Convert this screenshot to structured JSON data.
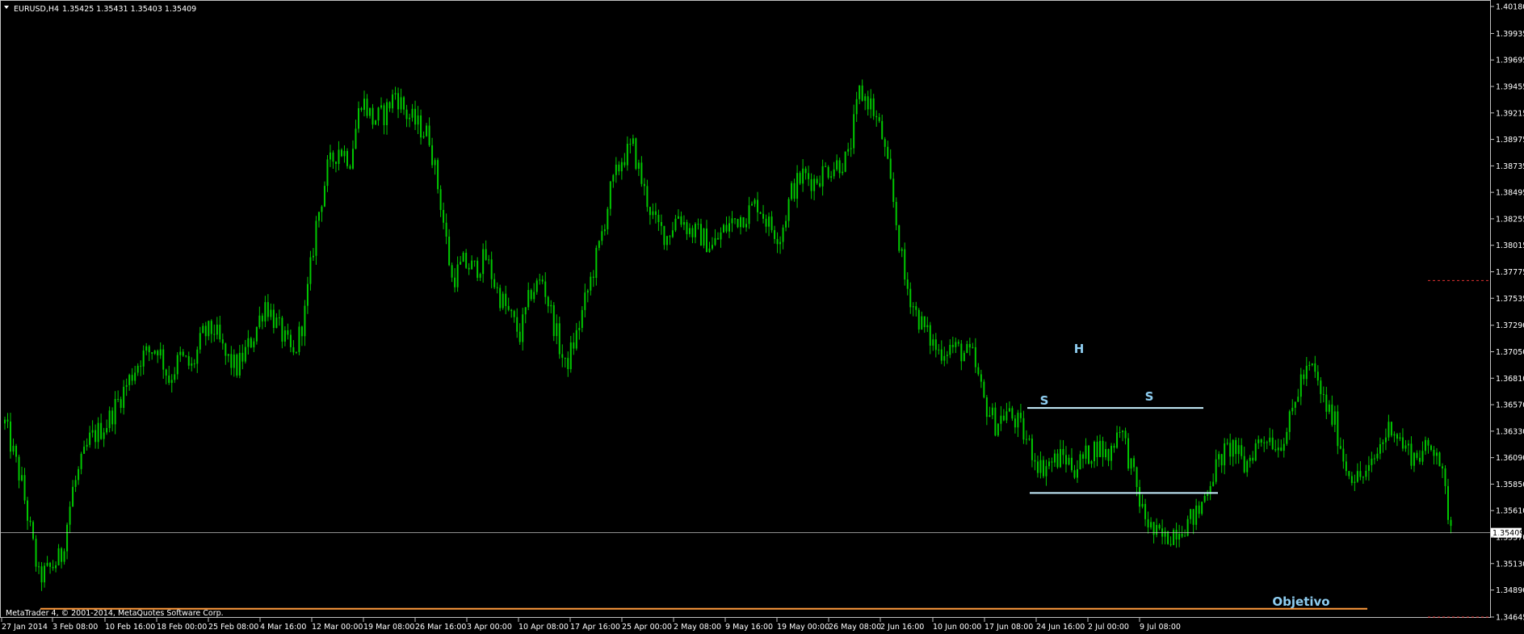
{
  "window": {
    "symbol_label": "EURUSD,H4",
    "ohlc_label": "1.35425 1.35431 1.35403 1.35409",
    "copyright": "MetaTrader 4, © 2001-2014, MetaQuotes Software Corp.",
    "dropdown_icon": "triangle-down-icon"
  },
  "colors": {
    "background": "#000000",
    "candles": "#00c800",
    "axis": "#c0c0c0",
    "pattern_lines": "#c8f0ff",
    "pattern_text": "#8ecdf0",
    "target_line": "#ff9a3c",
    "bid_line": "#c0c0c0",
    "alert_marker": "#e03030"
  },
  "chart_data": {
    "type": "bar",
    "symbol": "EURUSD",
    "timeframe": "H4",
    "current_price": "1.35409",
    "ylim": [
      1.34645,
      1.4018
    ],
    "y_ticks": [
      "1.40180",
      "1.39935",
      "1.39695",
      "1.39455",
      "1.39215",
      "1.38975",
      "1.38735",
      "1.38495",
      "1.38255",
      "1.38015",
      "1.37775",
      "1.37535",
      "1.37290",
      "1.37050",
      "1.36810",
      "1.36570",
      "1.36330",
      "1.36090",
      "1.35850",
      "1.35610",
      "1.35370",
      "1.35130",
      "1.34890",
      "1.34645"
    ],
    "x_ticks": [
      "27 Jan 2014",
      "3 Feb 08:00",
      "10 Feb 16:00",
      "18 Feb 00:00",
      "25 Feb 08:00",
      "4 Mar 16:00",
      "12 Mar 00:00",
      "19 Mar 08:00",
      "26 Mar 16:00",
      "3 Apr 00:00",
      "10 Apr 08:00",
      "17 Apr 16:00",
      "25 Apr 00:00",
      "2 May 08:00",
      "9 May 16:00",
      "19 May 00:00",
      "26 May 08:00",
      "2 Jun 16:00",
      "10 Jun 00:00",
      "17 Jun 08:00",
      "24 Jun 16:00",
      "2 Jul 00:00",
      "9 Jul 08:00"
    ],
    "price_path": [
      [
        0,
        1.364
      ],
      [
        6,
        1.3585
      ],
      [
        12,
        1.35
      ],
      [
        16,
        1.3508
      ],
      [
        20,
        1.352
      ],
      [
        24,
        1.358
      ],
      [
        30,
        1.3625
      ],
      [
        36,
        1.364
      ],
      [
        40,
        1.366
      ],
      [
        48,
        1.37
      ],
      [
        54,
        1.371
      ],
      [
        58,
        1.368
      ],
      [
        62,
        1.37
      ],
      [
        66,
        1.369
      ],
      [
        70,
        1.372
      ],
      [
        74,
        1.3725
      ],
      [
        78,
        1.37
      ],
      [
        82,
        1.369
      ],
      [
        88,
        1.372
      ],
      [
        92,
        1.375
      ],
      [
        98,
        1.372
      ],
      [
        102,
        1.37
      ],
      [
        106,
        1.374
      ],
      [
        110,
        1.382
      ],
      [
        114,
        1.387
      ],
      [
        118,
        1.389
      ],
      [
        122,
        1.388
      ],
      [
        126,
        1.3935
      ],
      [
        130,
        1.3915
      ],
      [
        134,
        1.392
      ],
      [
        138,
        1.394
      ],
      [
        142,
        1.392
      ],
      [
        146,
        1.391
      ],
      [
        150,
        1.39
      ],
      [
        154,
        1.384
      ],
      [
        158,
        1.377
      ],
      [
        162,
        1.3785
      ],
      [
        166,
        1.378
      ],
      [
        170,
        1.379
      ],
      [
        174,
        1.376
      ],
      [
        178,
        1.374
      ],
      [
        182,
        1.372
      ],
      [
        186,
        1.376
      ],
      [
        190,
        1.377
      ],
      [
        194,
        1.373
      ],
      [
        198,
        1.369
      ],
      [
        202,
        1.372
      ],
      [
        206,
        1.376
      ],
      [
        210,
        1.38
      ],
      [
        214,
        1.385
      ],
      [
        218,
        1.388
      ],
      [
        222,
        1.389
      ],
      [
        226,
        1.385
      ],
      [
        230,
        1.382
      ],
      [
        234,
        1.381
      ],
      [
        238,
        1.383
      ],
      [
        242,
        1.3815
      ],
      [
        246,
        1.381
      ],
      [
        250,
        1.38
      ],
      [
        254,
        1.3815
      ],
      [
        258,
        1.3825
      ],
      [
        262,
        1.383
      ],
      [
        266,
        1.384
      ],
      [
        270,
        1.382
      ],
      [
        274,
        1.381
      ],
      [
        278,
        1.385
      ],
      [
        282,
        1.3865
      ],
      [
        286,
        1.386
      ],
      [
        290,
        1.387
      ],
      [
        294,
        1.3875
      ],
      [
        298,
        1.388
      ],
      [
        302,
        1.394
      ],
      [
        306,
        1.393
      ],
      [
        310,
        1.39
      ],
      [
        314,
        1.384
      ],
      [
        318,
        1.377
      ],
      [
        322,
        1.374
      ],
      [
        326,
        1.372
      ],
      [
        330,
        1.3705
      ],
      [
        334,
        1.371
      ],
      [
        338,
        1.3705
      ],
      [
        342,
        1.37
      ],
      [
        346,
        1.366
      ],
      [
        350,
        1.364
      ],
      [
        354,
        1.365
      ],
      [
        358,
        1.364
      ],
      [
        362,
        1.362
      ],
      [
        366,
        1.36
      ],
      [
        370,
        1.3605
      ],
      [
        374,
        1.361
      ],
      [
        378,
        1.36
      ],
      [
        382,
        1.361
      ],
      [
        386,
        1.362
      ],
      [
        390,
        1.361
      ],
      [
        394,
        1.364
      ],
      [
        398,
        1.36
      ],
      [
        402,
        1.356
      ],
      [
        406,
        1.354
      ],
      [
        410,
        1.3535
      ],
      [
        414,
        1.3545
      ],
      [
        418,
        1.355
      ],
      [
        422,
        1.356
      ],
      [
        426,
        1.359
      ],
      [
        430,
        1.361
      ],
      [
        434,
        1.362
      ],
      [
        438,
        1.36
      ],
      [
        442,
        1.362
      ],
      [
        446,
        1.363
      ],
      [
        450,
        1.362
      ],
      [
        454,
        1.364
      ],
      [
        458,
        1.368
      ],
      [
        462,
        1.369
      ],
      [
        466,
        1.366
      ],
      [
        470,
        1.364
      ],
      [
        474,
        1.36
      ],
      [
        478,
        1.359
      ],
      [
        482,
        1.3595
      ],
      [
        486,
        1.362
      ],
      [
        490,
        1.364
      ],
      [
        494,
        1.362
      ],
      [
        498,
        1.361
      ],
      [
        502,
        1.3615
      ],
      [
        506,
        1.362
      ],
      [
        510,
        1.356
      ],
      [
        512,
        1.354
      ]
    ],
    "annotations": {
      "left_shoulder": "S",
      "head": "H",
      "right_shoulder": "S",
      "target_label": "Objetivo",
      "upper_line_price": 1.3654,
      "neckline_price": 1.3577,
      "target_price": 1.3472
    }
  }
}
